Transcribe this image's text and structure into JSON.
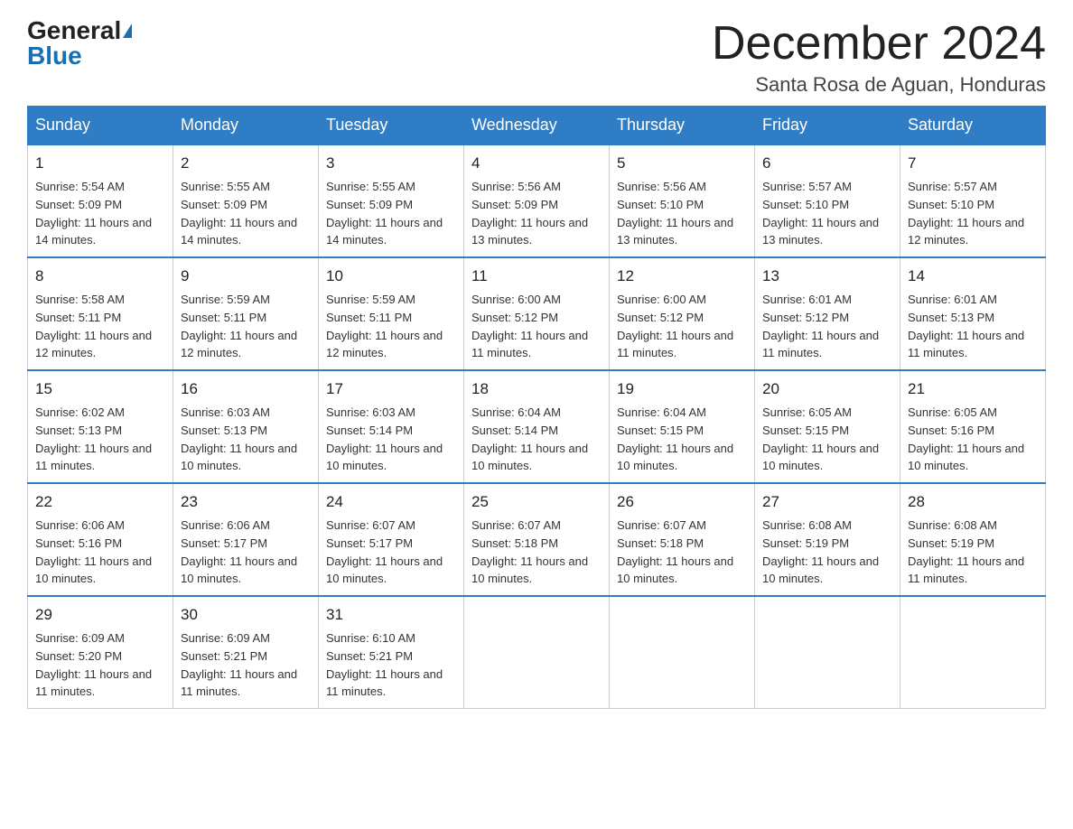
{
  "logo": {
    "general": "General",
    "blue": "Blue"
  },
  "title": {
    "month": "December 2024",
    "location": "Santa Rosa de Aguan, Honduras"
  },
  "days_of_week": [
    "Sunday",
    "Monday",
    "Tuesday",
    "Wednesday",
    "Thursday",
    "Friday",
    "Saturday"
  ],
  "weeks": [
    [
      {
        "day": "1",
        "sunrise": "5:54 AM",
        "sunset": "5:09 PM",
        "daylight": "11 hours and 14 minutes."
      },
      {
        "day": "2",
        "sunrise": "5:55 AM",
        "sunset": "5:09 PM",
        "daylight": "11 hours and 14 minutes."
      },
      {
        "day": "3",
        "sunrise": "5:55 AM",
        "sunset": "5:09 PM",
        "daylight": "11 hours and 14 minutes."
      },
      {
        "day": "4",
        "sunrise": "5:56 AM",
        "sunset": "5:09 PM",
        "daylight": "11 hours and 13 minutes."
      },
      {
        "day": "5",
        "sunrise": "5:56 AM",
        "sunset": "5:10 PM",
        "daylight": "11 hours and 13 minutes."
      },
      {
        "day": "6",
        "sunrise": "5:57 AM",
        "sunset": "5:10 PM",
        "daylight": "11 hours and 13 minutes."
      },
      {
        "day": "7",
        "sunrise": "5:57 AM",
        "sunset": "5:10 PM",
        "daylight": "11 hours and 12 minutes."
      }
    ],
    [
      {
        "day": "8",
        "sunrise": "5:58 AM",
        "sunset": "5:11 PM",
        "daylight": "11 hours and 12 minutes."
      },
      {
        "day": "9",
        "sunrise": "5:59 AM",
        "sunset": "5:11 PM",
        "daylight": "11 hours and 12 minutes."
      },
      {
        "day": "10",
        "sunrise": "5:59 AM",
        "sunset": "5:11 PM",
        "daylight": "11 hours and 12 minutes."
      },
      {
        "day": "11",
        "sunrise": "6:00 AM",
        "sunset": "5:12 PM",
        "daylight": "11 hours and 11 minutes."
      },
      {
        "day": "12",
        "sunrise": "6:00 AM",
        "sunset": "5:12 PM",
        "daylight": "11 hours and 11 minutes."
      },
      {
        "day": "13",
        "sunrise": "6:01 AM",
        "sunset": "5:12 PM",
        "daylight": "11 hours and 11 minutes."
      },
      {
        "day": "14",
        "sunrise": "6:01 AM",
        "sunset": "5:13 PM",
        "daylight": "11 hours and 11 minutes."
      }
    ],
    [
      {
        "day": "15",
        "sunrise": "6:02 AM",
        "sunset": "5:13 PM",
        "daylight": "11 hours and 11 minutes."
      },
      {
        "day": "16",
        "sunrise": "6:03 AM",
        "sunset": "5:13 PM",
        "daylight": "11 hours and 10 minutes."
      },
      {
        "day": "17",
        "sunrise": "6:03 AM",
        "sunset": "5:14 PM",
        "daylight": "11 hours and 10 minutes."
      },
      {
        "day": "18",
        "sunrise": "6:04 AM",
        "sunset": "5:14 PM",
        "daylight": "11 hours and 10 minutes."
      },
      {
        "day": "19",
        "sunrise": "6:04 AM",
        "sunset": "5:15 PM",
        "daylight": "11 hours and 10 minutes."
      },
      {
        "day": "20",
        "sunrise": "6:05 AM",
        "sunset": "5:15 PM",
        "daylight": "11 hours and 10 minutes."
      },
      {
        "day": "21",
        "sunrise": "6:05 AM",
        "sunset": "5:16 PM",
        "daylight": "11 hours and 10 minutes."
      }
    ],
    [
      {
        "day": "22",
        "sunrise": "6:06 AM",
        "sunset": "5:16 PM",
        "daylight": "11 hours and 10 minutes."
      },
      {
        "day": "23",
        "sunrise": "6:06 AM",
        "sunset": "5:17 PM",
        "daylight": "11 hours and 10 minutes."
      },
      {
        "day": "24",
        "sunrise": "6:07 AM",
        "sunset": "5:17 PM",
        "daylight": "11 hours and 10 minutes."
      },
      {
        "day": "25",
        "sunrise": "6:07 AM",
        "sunset": "5:18 PM",
        "daylight": "11 hours and 10 minutes."
      },
      {
        "day": "26",
        "sunrise": "6:07 AM",
        "sunset": "5:18 PM",
        "daylight": "11 hours and 10 minutes."
      },
      {
        "day": "27",
        "sunrise": "6:08 AM",
        "sunset": "5:19 PM",
        "daylight": "11 hours and 10 minutes."
      },
      {
        "day": "28",
        "sunrise": "6:08 AM",
        "sunset": "5:19 PM",
        "daylight": "11 hours and 11 minutes."
      }
    ],
    [
      {
        "day": "29",
        "sunrise": "6:09 AM",
        "sunset": "5:20 PM",
        "daylight": "11 hours and 11 minutes."
      },
      {
        "day": "30",
        "sunrise": "6:09 AM",
        "sunset": "5:21 PM",
        "daylight": "11 hours and 11 minutes."
      },
      {
        "day": "31",
        "sunrise": "6:10 AM",
        "sunset": "5:21 PM",
        "daylight": "11 hours and 11 minutes."
      },
      null,
      null,
      null,
      null
    ]
  ]
}
